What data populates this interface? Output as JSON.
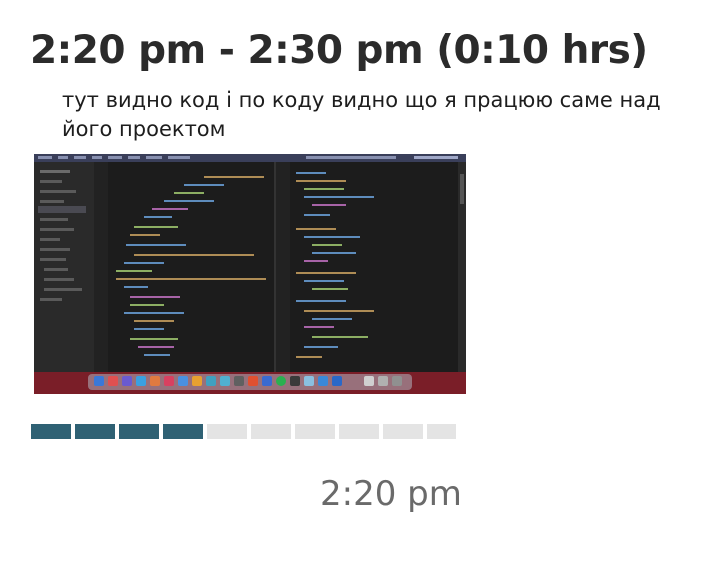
{
  "entry": {
    "title": "2:20 pm - 2:30 pm (0:10 hrs)",
    "memo": "тут видно код і по коду видно що я працюю саме над його проектом",
    "activity_segments_filled": 4,
    "activity_segments_total": 10,
    "activity_color": "#2f6174",
    "screenshot_time": "2:20 pm"
  },
  "screenshot": {
    "icon": "code-editor-screenshot-thumbnail"
  }
}
